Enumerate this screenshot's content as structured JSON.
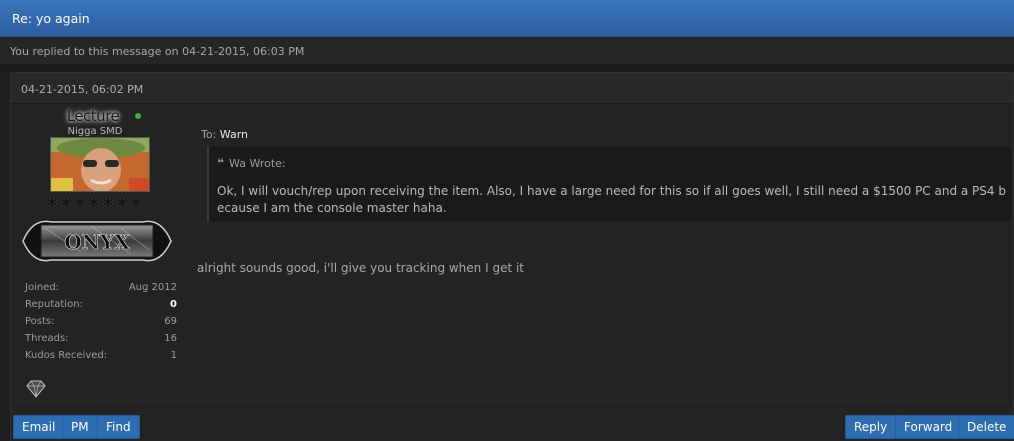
{
  "window": {
    "title": "Re: yo again"
  },
  "replied_notice": "You replied to this message on 04-21-2015, 06:03 PM",
  "post": {
    "date": "04-21-2015, 06:02 PM",
    "author": {
      "username": "Lecture",
      "title": "Nigga SMD",
      "rank_badge": "ONYX",
      "online": true,
      "stars": 7,
      "stats": {
        "joined_label": "Joined:",
        "joined": "Aug 2012",
        "reputation_label": "Reputation:",
        "reputation": "0",
        "posts_label": "Posts:",
        "posts": "69",
        "threads_label": "Threads:",
        "threads": "16",
        "kudos_label": "Kudos Received:",
        "kudos": "1"
      }
    },
    "to_label": "To:",
    "to_name": "Warn",
    "quote": {
      "header": "Wa Wrote:",
      "text": "Ok, I will vouch/rep upon receiving the item. Also, I have a large need for this so if all goes well, I still need a $1500 PC and a PS4 because I am the console master haha."
    },
    "message": "alright sounds good, i'll give you tracking when I get it"
  },
  "actions": {
    "left": {
      "email": "Email",
      "pm": "PM",
      "find": "Find"
    },
    "right": {
      "reply": "Reply",
      "forward": "Forward",
      "delete": "Delete"
    }
  },
  "colors": {
    "title_bar": "#2f67ab",
    "button": "#2f6db2",
    "online": "#3fb03f"
  },
  "icons": {
    "quote": "quote-icon",
    "online": "online-status-icon",
    "gem": "diamond-icon"
  }
}
